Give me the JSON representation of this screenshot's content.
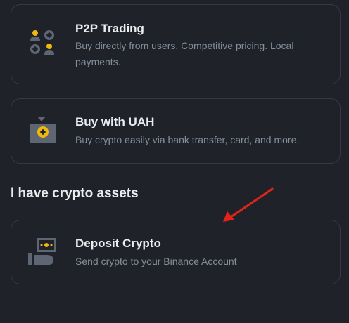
{
  "options": [
    {
      "title": "P2P Trading",
      "description": "Buy directly from users. Competitive pricing. Local payments.",
      "icon": "p2p-trading-icon"
    },
    {
      "title": "Buy with UAH",
      "description": "Buy crypto easily via bank transfer, card, and more.",
      "icon": "buy-with-fiat-icon"
    }
  ],
  "section": {
    "title": "I have crypto assets"
  },
  "deposit": {
    "title": "Deposit Crypto",
    "description": "Send crypto to your Binance Account",
    "icon": "deposit-crypto-icon"
  },
  "annotation": {
    "type": "red-arrow",
    "color": "#e0241b"
  },
  "colors": {
    "background": "#1f2329",
    "card_border": "#343a43",
    "title": "#eaecef",
    "description": "#848e9c",
    "accent": "#f0b90b",
    "icon_gray": "#5e6673"
  }
}
